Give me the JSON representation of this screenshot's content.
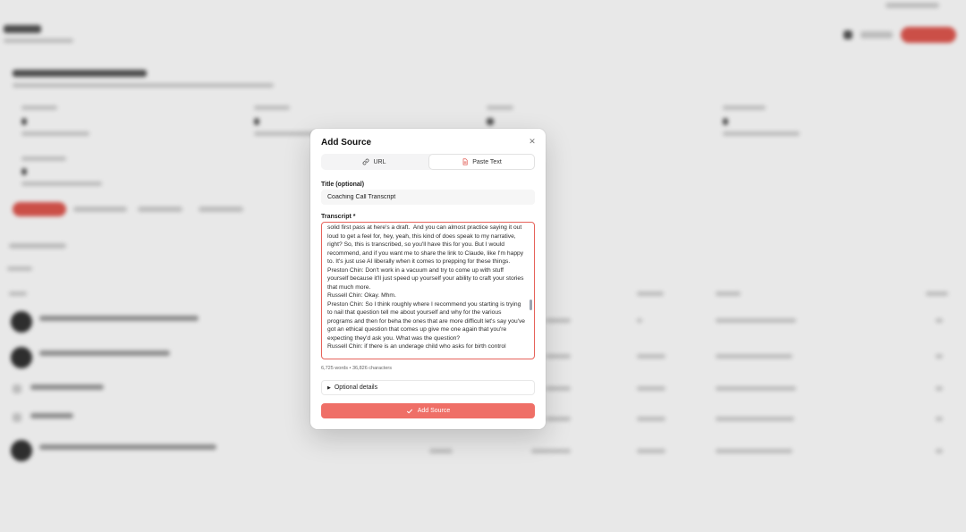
{
  "modal": {
    "title": "Add Source",
    "tabs": [
      {
        "label": "URL",
        "icon": "link-icon",
        "active": false
      },
      {
        "label": "Paste Text",
        "icon": "document-icon",
        "active": true
      }
    ],
    "title_field": {
      "label": "Title (optional)",
      "value": "Coaching Call Transcript"
    },
    "transcript_field": {
      "label": "Transcript *",
      "value": "solid first pass at here's a draft.  And you can almost practice saying it out loud to get a feel for, hey, yeah, this kind of does speak to my narrative, right? So, this is transcribed, so you'll have this for you. But I would recommend, and if you want me to share the link to Claude, like I'm happy to. It's just use AI liberally when it comes to prepping for these things.\nPreston Chin: Don't work in a vacuum and try to come up with stuff yourself because it'll just speed up yourself your ability to craft your stories that much more.\nRussell Chin: Okay. Mhm.\nPreston Chin: So I think roughly where I recommend you starting is trying to nail that question tell me about yourself and why for the various programs and then for beha the ones that are more difficult let's say you've got an ethical question that comes up give me one again that you're expecting they'd ask you. What was the question?\nRussell Chin: if there is an underage child who asks for birth control"
    },
    "count_text": "6,725 words • 36,826 characters",
    "optional_details": "Optional details",
    "submit_label": "Add Source"
  },
  "colors": {
    "accent": "#ef6f67",
    "focus_border": "#e6625a"
  }
}
